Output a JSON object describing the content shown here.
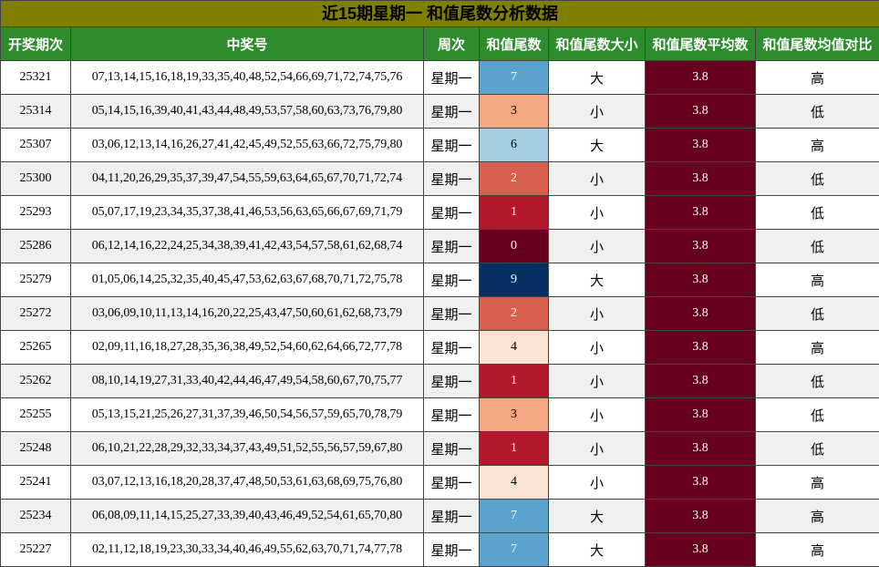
{
  "title": "近15期星期一 和值尾数分析数据",
  "colors": {
    "title_bg": "#7f7f00",
    "header_bg": "#2e8b2e",
    "avg_bg": "#67001f",
    "tail_scale": {
      "0": "#67001f",
      "1": "#b2182b",
      "2": "#d6604d",
      "3": "#f4a582",
      "4": "#fbe3d4",
      "6": "#a6cee3",
      "7": "#5ba3cf",
      "9": "#053061"
    }
  },
  "headers": [
    "开奖期次",
    "中奖号",
    "周次",
    "和值尾数",
    "和值尾数大小",
    "和值尾数平均数",
    "和值尾数均值对比"
  ],
  "rows": [
    {
      "period": "25321",
      "numbers": "07,13,14,15,16,18,19,33,35,40,48,52,54,66,69,71,72,74,75,76",
      "weekday": "星期一",
      "tail": "7",
      "size": "大",
      "avg": "3.8",
      "compare": "高"
    },
    {
      "period": "25314",
      "numbers": "05,14,15,16,39,40,41,43,44,48,49,53,57,58,60,63,73,76,79,80",
      "weekday": "星期一",
      "tail": "3",
      "size": "小",
      "avg": "3.8",
      "compare": "低"
    },
    {
      "period": "25307",
      "numbers": "03,06,12,13,14,16,26,27,41,42,45,49,52,55,63,66,72,75,79,80",
      "weekday": "星期一",
      "tail": "6",
      "size": "大",
      "avg": "3.8",
      "compare": "高"
    },
    {
      "period": "25300",
      "numbers": "04,11,20,26,29,35,37,39,47,54,55,59,63,64,65,67,70,71,72,74",
      "weekday": "星期一",
      "tail": "2",
      "size": "小",
      "avg": "3.8",
      "compare": "低"
    },
    {
      "period": "25293",
      "numbers": "05,07,17,19,23,34,35,37,38,41,46,53,56,63,65,66,67,69,71,79",
      "weekday": "星期一",
      "tail": "1",
      "size": "小",
      "avg": "3.8",
      "compare": "低"
    },
    {
      "period": "25286",
      "numbers": "06,12,14,16,22,24,25,34,38,39,41,42,43,54,57,58,61,62,68,74",
      "weekday": "星期一",
      "tail": "0",
      "size": "小",
      "avg": "3.8",
      "compare": "低"
    },
    {
      "period": "25279",
      "numbers": "01,05,06,14,25,32,35,40,45,47,53,62,63,67,68,70,71,72,75,78",
      "weekday": "星期一",
      "tail": "9",
      "size": "大",
      "avg": "3.8",
      "compare": "高"
    },
    {
      "period": "25272",
      "numbers": "03,06,09,10,11,13,14,16,20,22,25,43,47,50,60,61,62,68,73,79",
      "weekday": "星期一",
      "tail": "2",
      "size": "小",
      "avg": "3.8",
      "compare": "低"
    },
    {
      "period": "25265",
      "numbers": "02,09,11,16,18,27,28,35,36,38,49,52,54,60,62,64,66,72,77,78",
      "weekday": "星期一",
      "tail": "4",
      "size": "小",
      "avg": "3.8",
      "compare": "高"
    },
    {
      "period": "25262",
      "numbers": "08,10,14,19,27,31,33,40,42,44,46,47,49,54,58,60,67,70,75,77",
      "weekday": "星期一",
      "tail": "1",
      "size": "小",
      "avg": "3.8",
      "compare": "低"
    },
    {
      "period": "25255",
      "numbers": "05,13,15,21,25,26,27,31,37,39,46,50,54,56,57,59,65,70,78,79",
      "weekday": "星期一",
      "tail": "3",
      "size": "小",
      "avg": "3.8",
      "compare": "低"
    },
    {
      "period": "25248",
      "numbers": "06,10,21,22,28,29,32,33,34,37,43,49,51,52,55,56,57,59,67,80",
      "weekday": "星期一",
      "tail": "1",
      "size": "小",
      "avg": "3.8",
      "compare": "低"
    },
    {
      "period": "25241",
      "numbers": "03,07,12,13,16,18,20,28,37,47,48,50,53,61,63,68,69,75,76,80",
      "weekday": "星期一",
      "tail": "4",
      "size": "小",
      "avg": "3.8",
      "compare": "高"
    },
    {
      "period": "25234",
      "numbers": "06,08,09,11,14,15,25,27,33,39,40,43,46,49,52,54,61,65,70,80",
      "weekday": "星期一",
      "tail": "7",
      "size": "大",
      "avg": "3.8",
      "compare": "高"
    },
    {
      "period": "25227",
      "numbers": "02,11,12,18,19,23,30,33,34,40,46,49,55,62,63,70,71,74,77,78",
      "weekday": "星期一",
      "tail": "7",
      "size": "大",
      "avg": "3.8",
      "compare": "高"
    }
  ]
}
